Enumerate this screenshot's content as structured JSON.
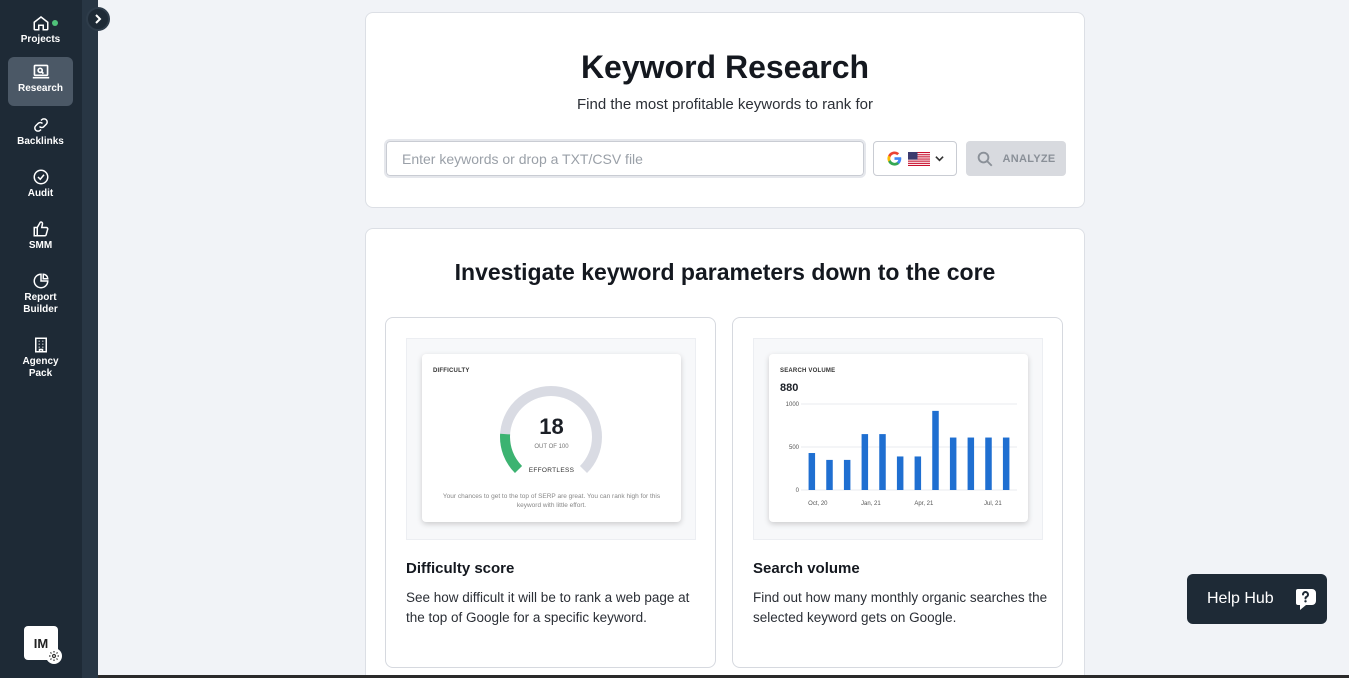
{
  "sidebar": {
    "items": [
      {
        "label": "Projects",
        "icon": "home-icon"
      },
      {
        "label": "Research",
        "icon": "laptop-search-icon",
        "active": true
      },
      {
        "label": "Backlinks",
        "icon": "link-icon"
      },
      {
        "label": "Audit",
        "icon": "check-circle-icon"
      },
      {
        "label": "SMM",
        "icon": "thumbs-up-icon"
      },
      {
        "label": "Report Builder",
        "icon": "pie-chart-icon"
      },
      {
        "label": "Agency Pack",
        "icon": "building-icon"
      }
    ],
    "avatar_initials": "IM"
  },
  "search": {
    "title": "Keyword Research",
    "subtitle": "Find the most profitable keywords to rank for",
    "placeholder": "Enter keywords or drop a TXT/CSV file",
    "value": "",
    "analyze_label": "ANALYZE"
  },
  "features": {
    "title": "Investigate keyword parameters down to the core",
    "difficulty": {
      "title": "Difficulty score",
      "description": "See how difficult it will be to rank a web page at the top of Google for a specific keyword.",
      "widget_label": "DIFFICULTY",
      "score": "18",
      "score_value": 18,
      "out_of": "OUT OF 100",
      "level": "EFFORTLESS",
      "note": "Your chances to get to the top of SERP are great. You can rank high for this keyword with little effort."
    },
    "volume": {
      "title": "Search volume",
      "description": "Find out how many monthly organic searches the selected keyword gets on Google.",
      "widget_label": "SEARCH VOLUME",
      "value": "880"
    }
  },
  "chart_data": {
    "type": "bar",
    "title": "SEARCH VOLUME",
    "ylim": [
      0,
      1000
    ],
    "yticks": [
      "0",
      "500",
      "1000"
    ],
    "xtick_labels": [
      "Oct, 20",
      "Jan, 21",
      "Apr, 21",
      "Jul, 21"
    ],
    "values": [
      430,
      350,
      350,
      650,
      650,
      390,
      390,
      920,
      610,
      610,
      610,
      610
    ],
    "color": "#1f6fd1"
  },
  "help_hub": {
    "label": "Help Hub"
  },
  "colors": {
    "sidebar": "#1e2a36",
    "active": "#4b5866",
    "accent_green": "#3cb371",
    "bar_blue": "#1f6fd1"
  }
}
